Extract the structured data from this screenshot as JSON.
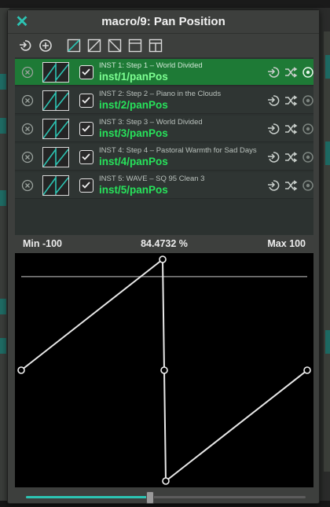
{
  "window": {
    "title": "macro/9: Pan Position"
  },
  "accent": "#2cc4b3",
  "toolbar": {
    "buttons": [
      {
        "name": "connect-icon"
      },
      {
        "name": "add-icon"
      },
      {
        "name": "curve-linear-up-icon"
      },
      {
        "name": "curve-linear-icon"
      },
      {
        "name": "curve-down-icon"
      },
      {
        "name": "curve-step-icon"
      },
      {
        "name": "curve-flat-icon"
      }
    ]
  },
  "mappings": [
    {
      "inst": "INST 1: Step 1 – World Divided",
      "address": "inst/1/panPos",
      "enabled": true,
      "selected": true
    },
    {
      "inst": "INST 2: Step 2 – Piano in the Clouds",
      "address": "inst/2/panPos",
      "enabled": true,
      "selected": false
    },
    {
      "inst": "INST 3: Step 3 – World Divided",
      "address": "inst/3/panPos",
      "enabled": true,
      "selected": false
    },
    {
      "inst": "INST 4: Step 4 – Pastoral Warmth for Sad Days",
      "address": "inst/4/panPos",
      "enabled": true,
      "selected": false
    },
    {
      "inst": "INST 5: WAVE – SQ 95 Clean 3",
      "address": "inst/5/panPos",
      "enabled": true,
      "selected": false
    }
  ],
  "range": {
    "min_label": "Min -100",
    "current_label": "84.4732 %",
    "max_label": "Max 100"
  },
  "graph": {
    "current_value": 0.8447,
    "points": [
      {
        "x": 0.0,
        "y": 0.0
      },
      {
        "x": 0.5,
        "y": 1.0
      },
      {
        "x": 0.5,
        "y": 0.0
      },
      {
        "x": 0.5,
        "y": -1.0
      },
      {
        "x": 1.0,
        "y": 0.0
      }
    ]
  },
  "slider": {
    "value": 0.444
  }
}
